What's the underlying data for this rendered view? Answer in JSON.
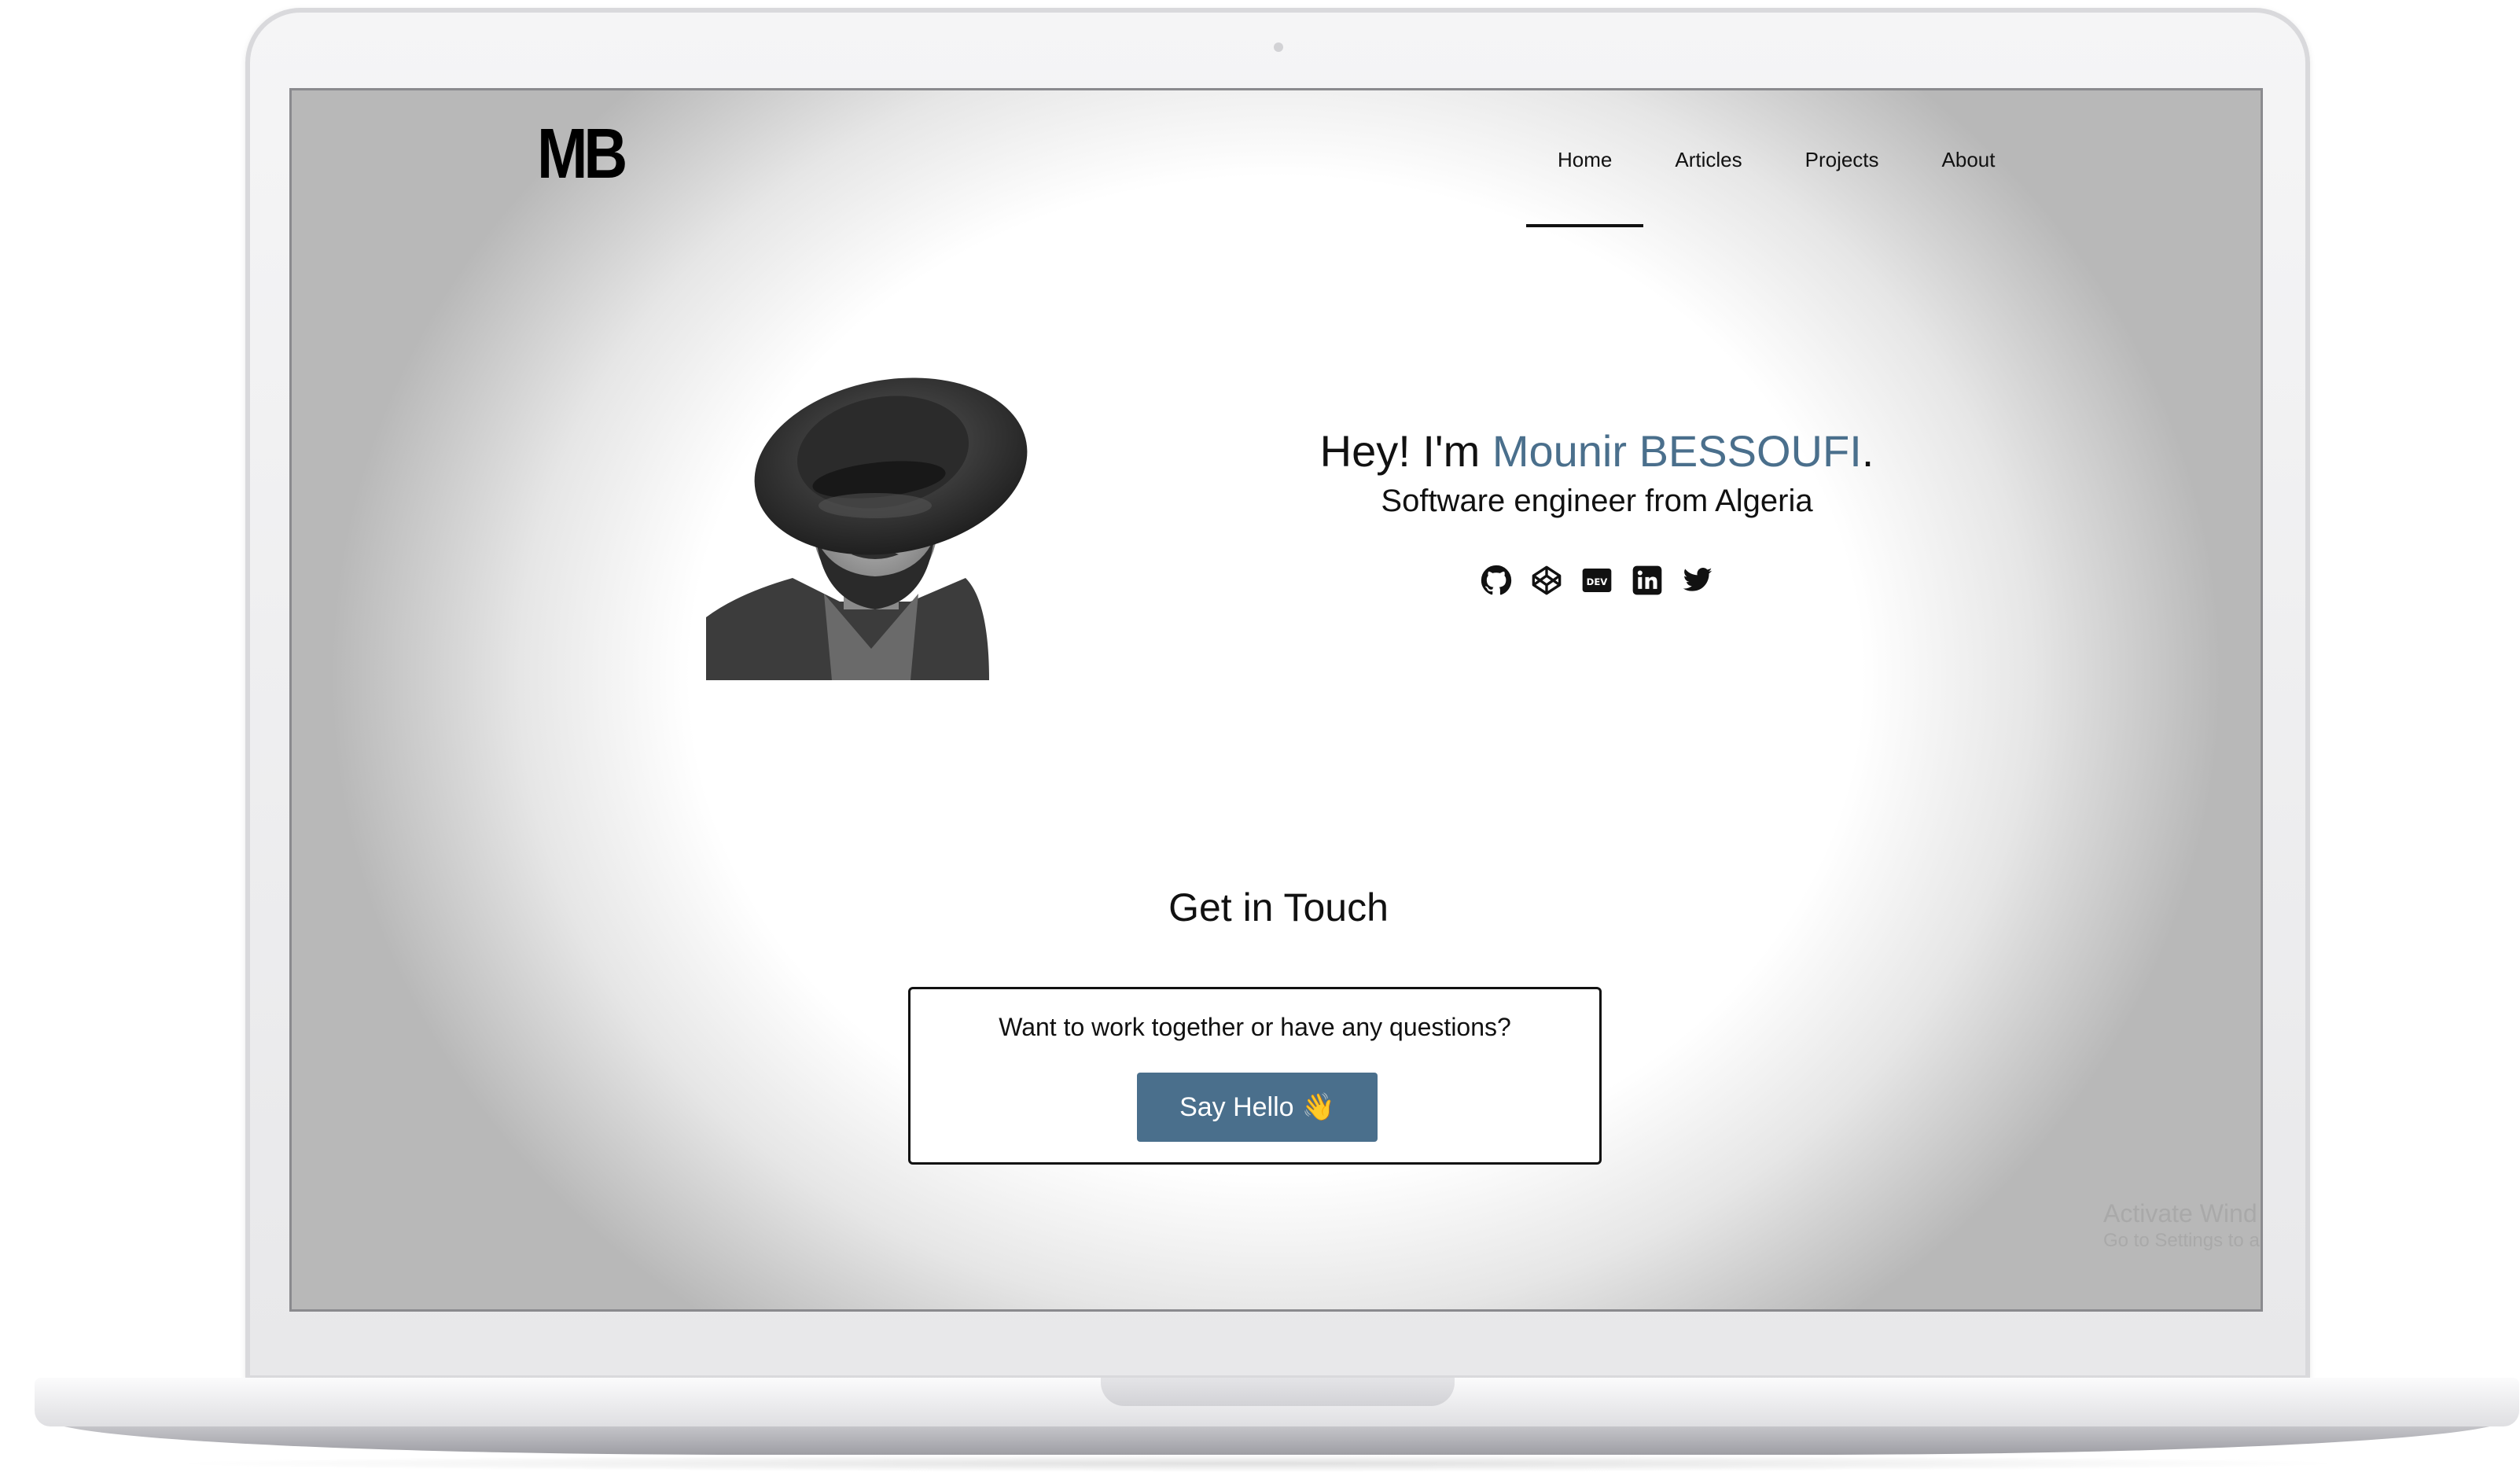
{
  "site": {
    "logo": "MB",
    "nav": [
      "Home",
      "Articles",
      "Projects",
      "About"
    ],
    "active_nav": "Home"
  },
  "hero": {
    "greeting_prefix": "Hey! I'm ",
    "name": "Mounir BESSOUFI",
    "greeting_suffix": ".",
    "subtitle": "Software engineer from Algeria",
    "socials": [
      "github-icon",
      "codepen-icon",
      "dev-icon",
      "linkedin-icon",
      "twitter-icon"
    ],
    "portrait_alt": "profile photo"
  },
  "contact": {
    "title": "Get in Touch",
    "question": "Want to work together or have any questions?",
    "button_label": "Say Hello",
    "button_emoji": "👋"
  },
  "watermark": {
    "title": "Activate Wind",
    "subtitle": "Go to Settings to a"
  },
  "colors": {
    "accent": "#4a6f8c",
    "text": "#111111",
    "screen_bg": "#ffffff"
  }
}
